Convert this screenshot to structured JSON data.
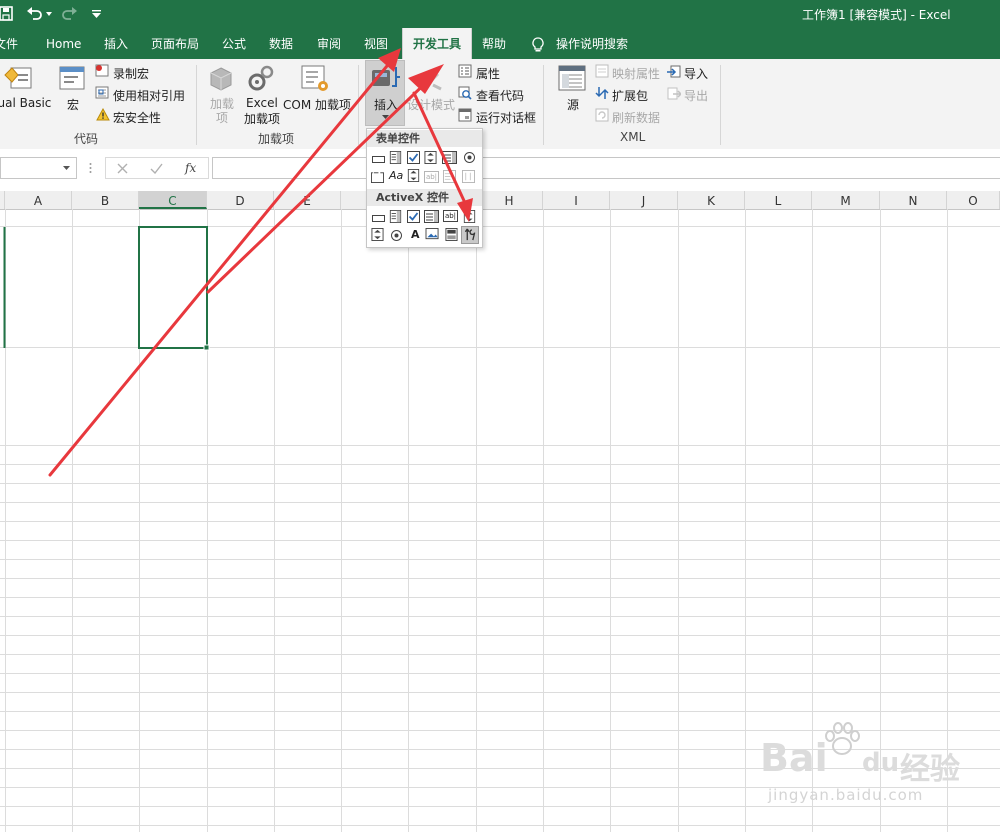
{
  "titlebar": {
    "document_title": "工作簿1 [兼容模式] - Excel"
  },
  "tabs": [
    {
      "label": "文件"
    },
    {
      "label": "Home"
    },
    {
      "label": "插入"
    },
    {
      "label": "页面布局"
    },
    {
      "label": "公式"
    },
    {
      "label": "数据"
    },
    {
      "label": "审阅"
    },
    {
      "label": "视图"
    },
    {
      "label": "开发工具"
    },
    {
      "label": "帮助"
    },
    {
      "label": "操作说明搜索"
    }
  ],
  "ribbon": {
    "code_group": {
      "label": "代码",
      "visual_basic": "Visual Basic",
      "macros": "宏",
      "record_macro": "录制宏",
      "relative_refs": "使用相对引用",
      "macro_security": "宏安全性"
    },
    "addins_group": {
      "label": "加载项",
      "addins": "加载项",
      "excel_addins_line1": "Excel",
      "excel_addins_line2": "加载项",
      "com_addins": "COM 加载项"
    },
    "controls_group": {
      "insert": "插入",
      "design_mode": "设计模式",
      "properties": "属性",
      "view_code": "查看代码",
      "run_dialog": "运行对话框"
    },
    "xml_group": {
      "label": "XML",
      "source": "源",
      "map_properties": "映射属性",
      "expansion_packs": "扩展包",
      "refresh_data": "刷新数据",
      "import": "导入",
      "export": "导出"
    }
  },
  "dropdown": {
    "form_controls_header": "表单控件",
    "activex_header": "ActiveX 控件",
    "label_glyph": "Aa",
    "label_control_glyph": "A",
    "textbox_glyph": "ab|"
  },
  "grid": {
    "columns": [
      "A",
      "B",
      "C",
      "D",
      "E",
      "F",
      "G",
      "H",
      "I",
      "J",
      "K",
      "L",
      "M",
      "N",
      "O"
    ],
    "selected_column": "C"
  },
  "watermark": {
    "brand": "Bai",
    "brand_suffix": "du",
    "brand_cn": "经验",
    "url": "jingyan.baidu.com"
  },
  "colors": {
    "accent": "#217346",
    "annotation_arrow": "#e8383d"
  }
}
